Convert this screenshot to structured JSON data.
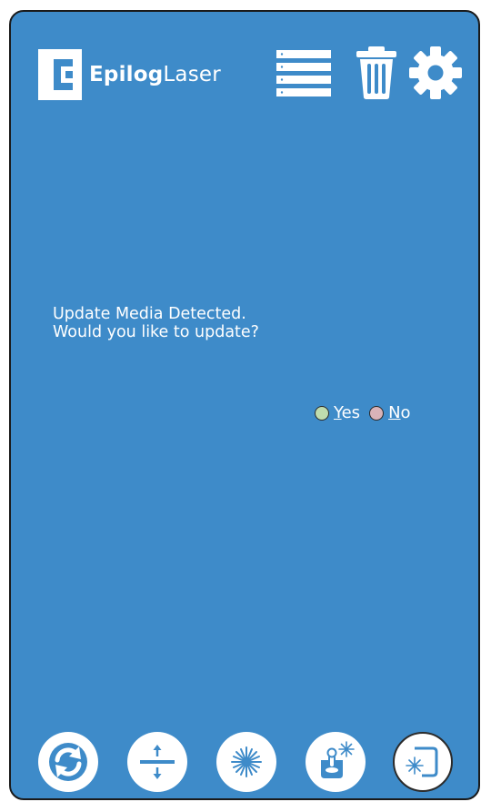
{
  "header": {
    "brand_bold": "Epilog",
    "brand_light": "Laser"
  },
  "toolbar": {
    "list_icon": "job-list-icon",
    "trash_icon": "trash-icon",
    "settings_icon": "gear-icon"
  },
  "dialog": {
    "line1": "Update Media Detected.",
    "line2": "Would you like to update?",
    "yes_accesskey": "Y",
    "yes_rest": "es",
    "no_accesskey": "N",
    "no_rest": "o"
  },
  "bottom_nav": [
    {
      "icon": "refresh-icon"
    },
    {
      "icon": "focus-height-icon"
    },
    {
      "icon": "laser-burst-icon"
    },
    {
      "icon": "laser-joystick-icon"
    },
    {
      "icon": "laser-frame-icon"
    }
  ],
  "colors": {
    "background": "#3e8bc9",
    "yes_radio": "#bfdcae",
    "no_radio": "#d9b3b8",
    "icon_blue": "#3e8bc9"
  }
}
